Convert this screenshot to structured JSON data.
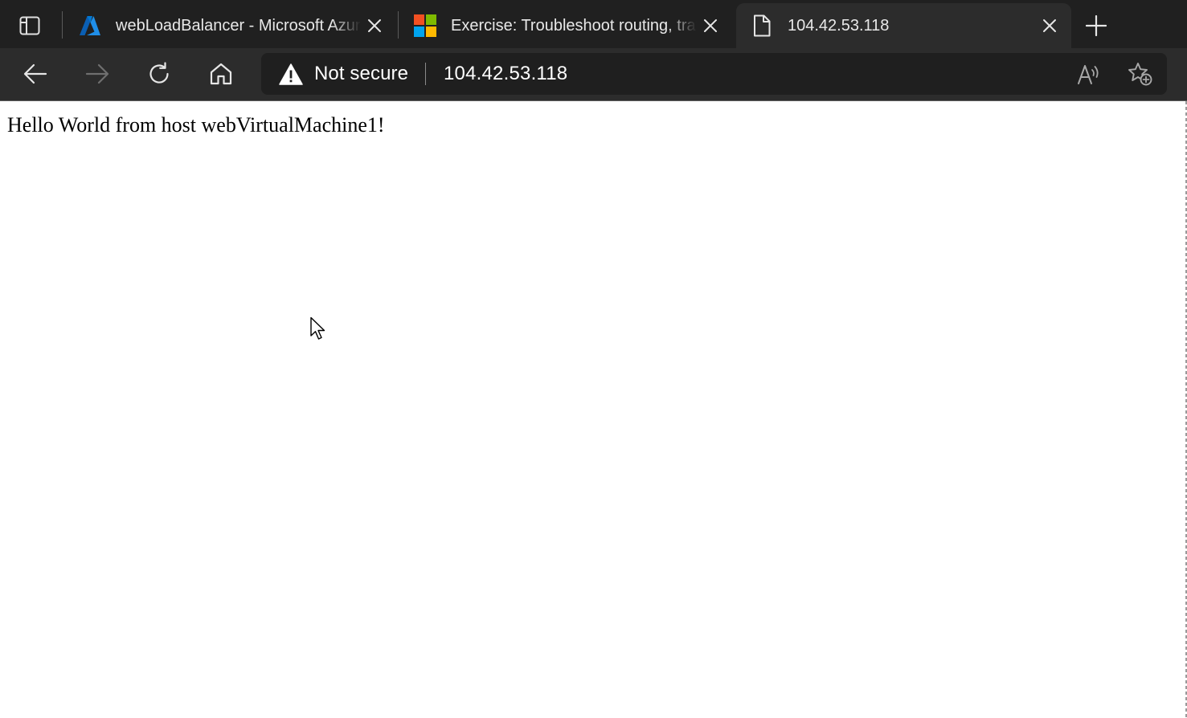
{
  "tabs": [
    {
      "title": "webLoadBalancer - Microsoft Azure",
      "favicon": "azure-logo-icon",
      "active": false,
      "close_label": "×"
    },
    {
      "title": "Exercise: Troubleshoot routing, traffic and connectivity",
      "favicon": "microsoft-logo-icon",
      "active": false,
      "close_label": "×"
    },
    {
      "title": "104.42.53.118",
      "favicon": "page-icon",
      "active": true,
      "close_label": "×"
    }
  ],
  "toolbar": {
    "security_label": "Not secure",
    "url": "104.42.53.118"
  },
  "page": {
    "text": "Hello World from host webVirtualMachine1!"
  },
  "colors": {
    "tabstrip_bg": "#202020",
    "toolbar_bg": "#2c2c2c",
    "addressbar_bg": "#1f1f1f",
    "azure_blue": "#0078d4",
    "ms_red": "#f25022",
    "ms_green": "#7fba00",
    "ms_blue": "#00a4ef",
    "ms_yellow": "#ffb900"
  }
}
